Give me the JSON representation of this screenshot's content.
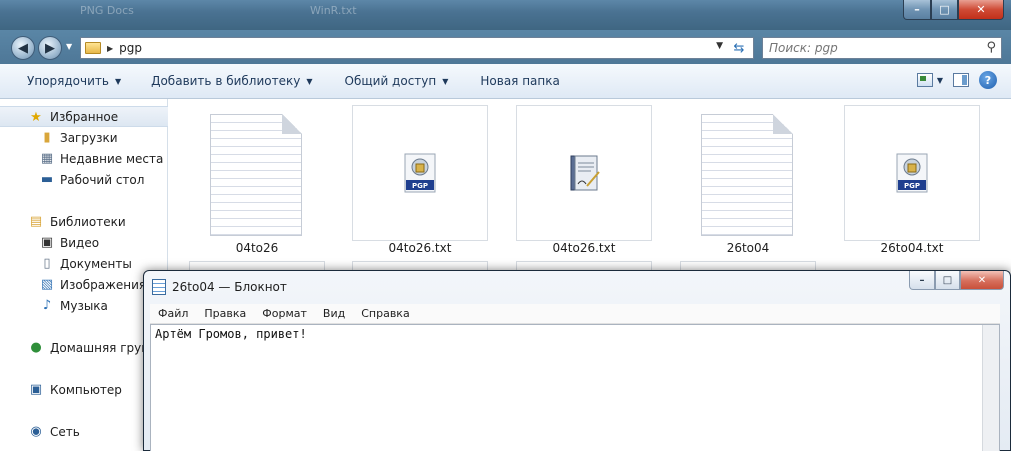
{
  "explorer": {
    "title_hint": "PNG Docs",
    "title_hint2": "WinR.txt",
    "address": {
      "path": "pgp"
    },
    "search": {
      "placeholder": "Поиск: pgp"
    },
    "window_controls": {
      "minimize": "–",
      "maximize": "□",
      "close": "✕"
    },
    "toolbar": {
      "organize": "Упорядочить",
      "add_to_library": "Добавить в библиотеку",
      "share": "Общий доступ",
      "new_folder": "Новая папка"
    },
    "sidebar": {
      "favorites": "Избранное",
      "downloads": "Загрузки",
      "recent": "Недавние места",
      "desktop": "Рабочий стол",
      "libraries": "Библиотеки",
      "video": "Видео",
      "documents": "Документы",
      "images": "Изображения",
      "music": "Музыка",
      "homegroup": "Домашняя групп",
      "computer": "Компьютер",
      "network": "Сеть"
    },
    "files": [
      {
        "name": "04to26",
        "icon": "blank-document-icon"
      },
      {
        "name": "04to26.txt",
        "icon": "pgp-file-icon"
      },
      {
        "name": "04to26.txt",
        "icon": "signed-document-icon"
      },
      {
        "name": "26to04",
        "icon": "blank-document-icon"
      },
      {
        "name": "26to04.txt",
        "icon": "pgp-file-icon"
      }
    ]
  },
  "notepad": {
    "title": "26to04 — Блокнот",
    "menu": [
      "Файл",
      "Правка",
      "Формат",
      "Вид",
      "Справка"
    ],
    "content": "Артём Громов, привет!"
  }
}
